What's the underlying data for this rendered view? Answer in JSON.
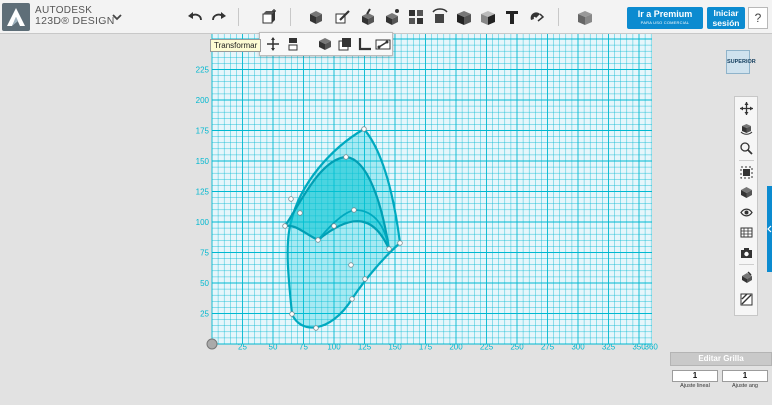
{
  "app": {
    "brand_line1": "AUTODESK",
    "brand_line2": "123D® DESIGN"
  },
  "toolbar": {
    "icons": [
      "undo-icon",
      "redo-icon",
      "primitives-icon",
      "sketch-icon",
      "construct-icon",
      "modify-icon",
      "pattern-icon",
      "grouping-icon",
      "combine-icon",
      "measure-icon",
      "text-icon",
      "snap-icon",
      "material-icon"
    ],
    "premium_label": "Ir a Premium",
    "premium_sub": "PARA USO COMERCIAL",
    "login_label_1": "Iniciar",
    "login_label_2": "sesión",
    "help_label": "?"
  },
  "flyout": {
    "tooltip": "Transformar",
    "items": [
      "move-icon",
      "scale-icon",
      "align-icon",
      "smart-scale-icon",
      "ruler-icon",
      "snap-icon"
    ]
  },
  "viewcube": {
    "label": "SUPERIOR"
  },
  "nav_panel": {
    "items": [
      "pan-icon",
      "orbit-icon",
      "zoom-icon",
      "fit-icon",
      "view-mode-icon",
      "visibility-icon",
      "materials-icon",
      "screenshot-icon",
      "grid-snap-icon",
      "settings-icon"
    ]
  },
  "grid": {
    "x_ticks": [
      "25",
      "50",
      "75",
      "100",
      "125",
      "150",
      "175",
      "200",
      "225",
      "250",
      "275",
      "300",
      "325",
      "350",
      "360"
    ],
    "y_ticks": [
      "225",
      "200",
      "175",
      "150",
      "125",
      "100",
      "75",
      "50",
      "25"
    ],
    "accent": "#00b8d0"
  },
  "grid_panel": {
    "title": "Editar Grilla",
    "linear_value": "1",
    "angle_value": "1",
    "linear_label": "Ajuste lineal",
    "angle_label": "Ajuste ang"
  }
}
